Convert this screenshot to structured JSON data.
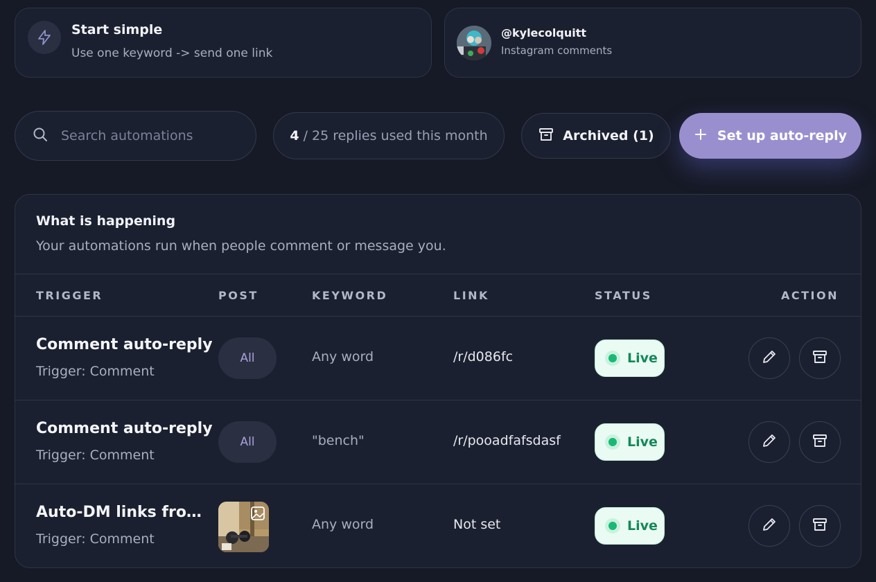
{
  "tip": {
    "title": "Start simple",
    "subtitle": "Use one keyword -> send one link",
    "icon": "bolt-icon"
  },
  "account": {
    "handle": "@kylecolquitt",
    "source": "Instagram comments"
  },
  "toolbar": {
    "search_placeholder": "Search automations",
    "usage_count": "4",
    "usage_rest": "/ 25 replies used this month",
    "archived_label": "Archived (1)",
    "setup_label": "Set up auto-reply"
  },
  "panel": {
    "title": "What is happening",
    "subtitle": "Your automations run when people comment or message you."
  },
  "columns": [
    "TRIGGER",
    "POST",
    "KEYWORD",
    "LINK",
    "STATUS",
    "ACTION"
  ],
  "rows": [
    {
      "title": "Comment auto-reply",
      "trigger": "Trigger: Comment",
      "post": "All",
      "keyword": "Any word",
      "link": "/r/d086fc",
      "status": "Live"
    },
    {
      "title": "Comment auto-reply",
      "trigger": "Trigger: Comment",
      "post": "All",
      "keyword": "\"bench\"",
      "link": "/r/pooadfafsdasf",
      "status": "Live"
    },
    {
      "title": "Auto-DM links fro…",
      "trigger": "Trigger: Comment",
      "post": "",
      "keyword": "Any word",
      "link": "Not set",
      "status": "Live"
    }
  ],
  "colors": {
    "accent": "#9a8fce",
    "live_bg": "#eafbf3",
    "live_text": "#14885a",
    "background": "#161a26"
  }
}
